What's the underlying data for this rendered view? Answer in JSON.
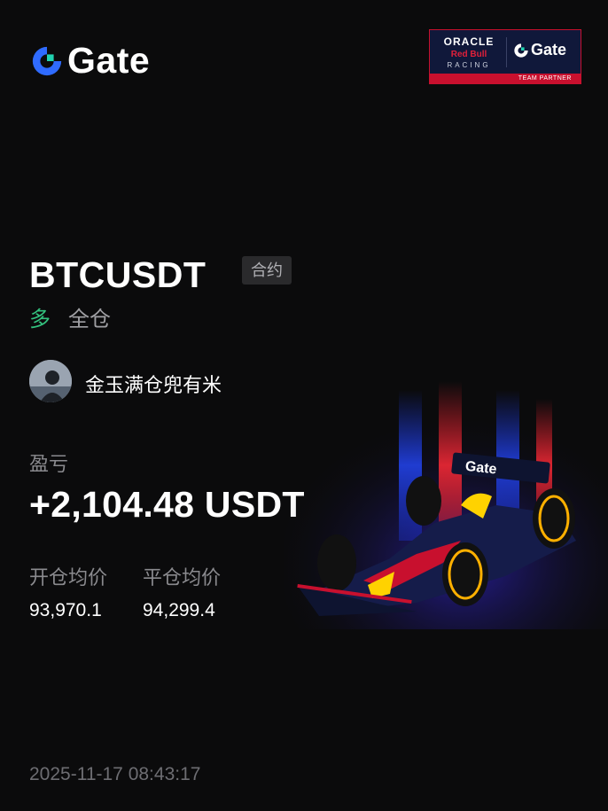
{
  "brand": {
    "name": "Gate",
    "logo_icon": "gate-logo-icon",
    "accent": "#2f6bff",
    "accent_light": "#21d3b0"
  },
  "partner": {
    "oracle": "ORACLE",
    "red_bull": "Red Bull",
    "racing": "RACING",
    "gate": "Gate",
    "team_partner": "TEAM PARTNER"
  },
  "trade": {
    "pair": "BTCUSDT",
    "contract_badge": "合约",
    "side": "多",
    "side_color": "#33c27e",
    "margin_mode": "全仓"
  },
  "user": {
    "name": "金玉满仓兜有米",
    "avatar_icon": "user-avatar"
  },
  "pnl": {
    "label": "盈亏",
    "value": "+2,104.48 USDT"
  },
  "prices": {
    "open_label": "开仓均价",
    "open_value": "93,970.1",
    "close_label": "平仓均价",
    "close_value": "94,299.4"
  },
  "timestamp": "2025-11-17 08:43:17",
  "illustration": {
    "name": "f1-race-car-image",
    "car_livery": "Gate"
  }
}
